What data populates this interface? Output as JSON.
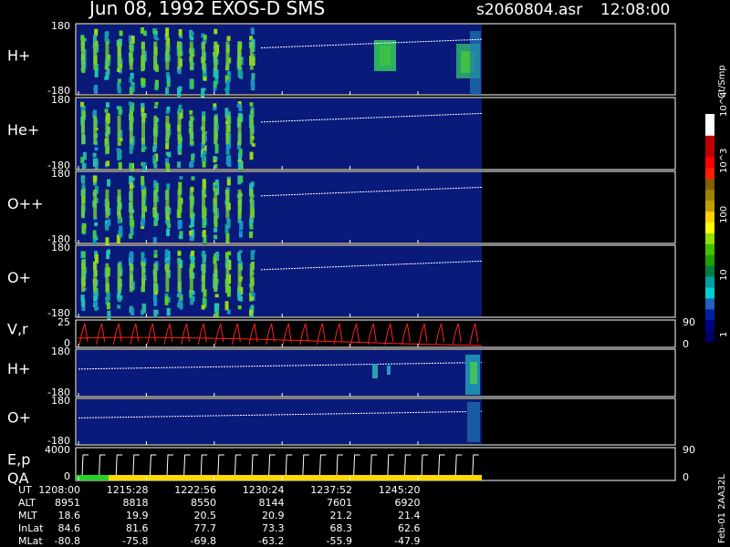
{
  "header": {
    "title": "Jun 08, 1992   EXOS-D SMS",
    "filename": "s2060804.asr",
    "time": "12:08:00"
  },
  "colorbar": {
    "unit": "Ct/Smp",
    "tick_labels": [
      "10^4",
      "10^3",
      "100",
      "10",
      "1"
    ]
  },
  "footer_tag": "Feb-01 2AA32L",
  "chart_data": [
    {
      "type": "heatmap",
      "panel": "H+ pitch-angle spectrogram",
      "ylabel": "H+",
      "ylim": [
        -180,
        180
      ],
      "y_tick_labels": [
        "180",
        "-180"
      ],
      "x_tick_labels": [
        "1208:00",
        "1215:28",
        "1222:56",
        "1230:24",
        "1237:52",
        "1245:20"
      ],
      "data_end_x": "~1251",
      "bursts": 15,
      "extra_patches": [
        {
          "x": "~1238"
        },
        {
          "x": "~1249"
        }
      ]
    },
    {
      "type": "heatmap",
      "panel": "He+ pitch-angle spectrogram",
      "ylabel": "He+",
      "ylim": [
        -180,
        180
      ],
      "y_tick_labels": [
        "180",
        "-180"
      ],
      "bursts": 15
    },
    {
      "type": "heatmap",
      "panel": "O++ pitch-angle spectrogram",
      "ylabel": "O++",
      "ylim": [
        -180,
        180
      ],
      "y_tick_labels": [
        "180",
        "-180"
      ],
      "bursts": 15
    },
    {
      "type": "heatmap",
      "panel": "O+ pitch-angle spectrogram",
      "ylabel": "O+",
      "ylim": [
        -180,
        180
      ],
      "y_tick_labels": [
        "180",
        "-180"
      ],
      "bursts": 15
    },
    {
      "type": "line",
      "panel": "V,r",
      "ylabel": "V,r",
      "ylim": [
        0,
        25
      ],
      "y_tick_labels": [
        "25",
        "0"
      ],
      "right_tick_labels": [
        "90",
        "0"
      ],
      "color": "#ff2020"
    },
    {
      "type": "heatmap",
      "panel": "H+ (second)",
      "ylabel": "H+",
      "ylim": [
        -180,
        180
      ],
      "y_tick_labels": [
        "180",
        "-180"
      ]
    },
    {
      "type": "heatmap",
      "panel": "O+ (second)",
      "ylabel": "O+",
      "ylim": [
        -180,
        180
      ],
      "y_tick_labels": [
        "180",
        "-180"
      ]
    },
    {
      "type": "line",
      "panel": "E,p / QA",
      "ylabel": "E,p",
      "ylabel2": "QA",
      "ylim": [
        0,
        4000
      ],
      "y_tick_labels": [
        "4000",
        "0"
      ],
      "right_tick_labels": [
        "90",
        "0"
      ]
    }
  ],
  "ephemeris": {
    "rows": [
      {
        "label": "UT",
        "values": [
          "1208:00",
          "1215:28",
          "1222:56",
          "1230:24",
          "1237:52",
          "1245:20"
        ]
      },
      {
        "label": "ALT",
        "values": [
          "8951",
          "8818",
          "8550",
          "8144",
          "7601",
          "6920"
        ]
      },
      {
        "label": "MLT",
        "values": [
          "18.6",
          "19.9",
          "20.5",
          "20.9",
          "21.2",
          "21.4"
        ]
      },
      {
        "label": "InLat",
        "values": [
          "84.6",
          "81.6",
          "77.7",
          "73.3",
          "68.3",
          "62.6"
        ]
      },
      {
        "label": "MLat",
        "values": [
          "-80.8",
          "-75.8",
          "-69.8",
          "-63.2",
          "-55.9",
          "-47.9"
        ]
      }
    ]
  }
}
